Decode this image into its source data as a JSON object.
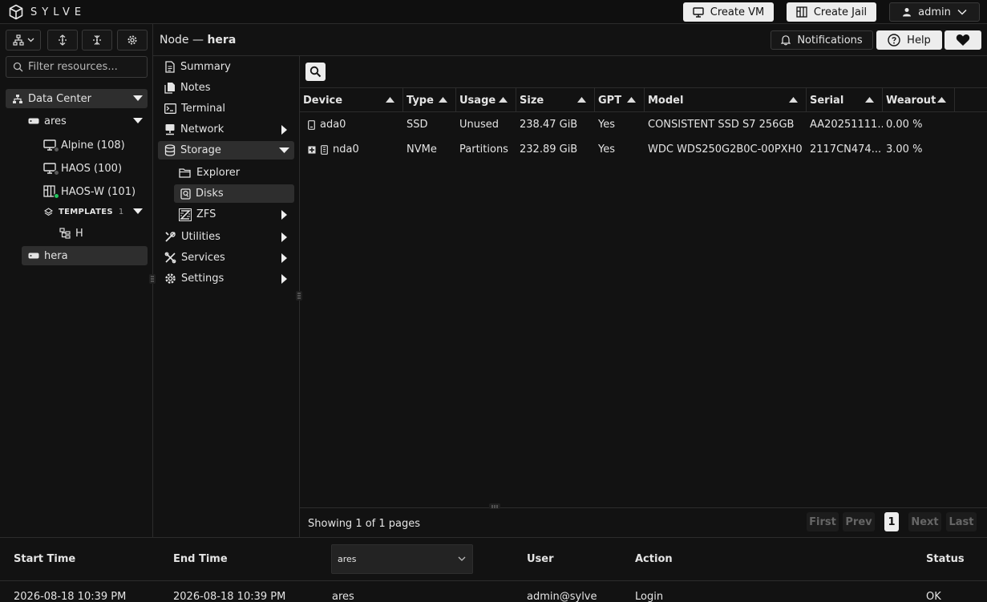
{
  "app": {
    "name": "SYLVE"
  },
  "topbar": {
    "create_vm": "Create VM",
    "create_jail": "Create Jail",
    "user": "admin"
  },
  "sidebar": {
    "filter_placeholder": "Filter resources...",
    "tree": {
      "datacenter": "Data Center",
      "nodes": [
        {
          "label": "ares"
        },
        {
          "label": "hera"
        }
      ],
      "guests": [
        {
          "label": "Alpine (108)",
          "status": "stopped"
        },
        {
          "label": "HAOS (100)",
          "status": "stopped"
        },
        {
          "label": "HAOS-W (101)",
          "status": "running"
        }
      ],
      "templates_label": "TEMPLATES",
      "templates_count": "1",
      "template_items": [
        {
          "label": "H"
        }
      ]
    }
  },
  "node_header": {
    "prefix": "Node —",
    "node": "hera",
    "notifications": "Notifications",
    "help": "Help"
  },
  "nav": {
    "items": [
      {
        "label": "Summary"
      },
      {
        "label": "Notes"
      },
      {
        "label": "Terminal"
      },
      {
        "label": "Network"
      },
      {
        "label": "Storage"
      },
      {
        "label": "Explorer"
      },
      {
        "label": "Disks"
      },
      {
        "label": "ZFS"
      },
      {
        "label": "Utilities"
      },
      {
        "label": "Services"
      },
      {
        "label": "Settings"
      }
    ]
  },
  "disks": {
    "columns": [
      "Device",
      "Type",
      "Usage",
      "Size",
      "GPT",
      "Model",
      "Serial",
      "Wearout"
    ],
    "rows": [
      {
        "device": "ada0",
        "type": "SSD",
        "usage": "Unused",
        "size": "238.47 GiB",
        "gpt": "Yes",
        "model": "CONSISTENT SSD S7 256GB",
        "serial": "AA20251111...",
        "wearout": "0.00 %"
      },
      {
        "device": "nda0",
        "type": "NVMe",
        "usage": "Partitions",
        "size": "232.89 GiB",
        "gpt": "Yes",
        "model": "WDC WDS250G2B0C-00PXH0",
        "serial": "2117CN474...",
        "wearout": "3.00 %"
      }
    ],
    "pager": {
      "text": "Showing 1 of 1 pages",
      "first": "First",
      "prev": "Prev",
      "page": "1",
      "next": "Next",
      "last": "Last"
    }
  },
  "log": {
    "columns": {
      "start": "Start Time",
      "end": "End Time",
      "node_filter": "ares",
      "user": "User",
      "action": "Action",
      "status": "Status"
    },
    "row": {
      "start": "2026-08-18 10:39 PM",
      "end": "2026-08-18 10:39 PM",
      "node": "ares",
      "user": "admin@sylve",
      "action": "Login",
      "status": "OK"
    }
  },
  "colors": {
    "accent_light": "#ededed",
    "running": "#22c55e",
    "stopped": "#5a5a5a"
  }
}
